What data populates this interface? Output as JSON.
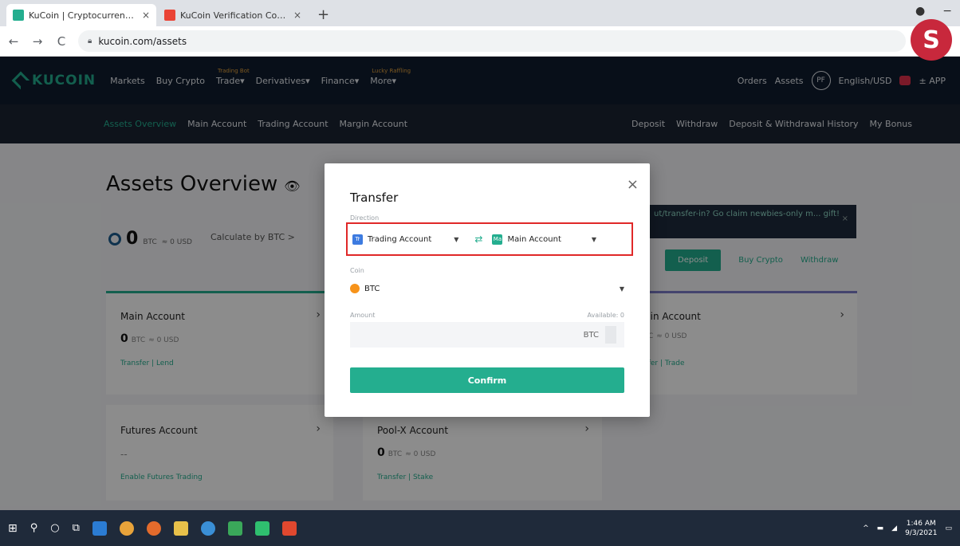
{
  "browser": {
    "tabs": [
      {
        "title": "KuCoin | Cryptocurrency Exchan...",
        "close": "×",
        "favicon_color": "#24ae8f"
      },
      {
        "title": "KuCoin Verification Code - phar...",
        "close": "×",
        "favicon_color": "#ea4335"
      }
    ],
    "new_tab": "+",
    "back": "←",
    "forward": "→",
    "reload": "C",
    "url": "kucoin.com/assets"
  },
  "header": {
    "logo": "KUCOIN",
    "nav": [
      {
        "label": "Markets",
        "tag": ""
      },
      {
        "label": "Buy Crypto",
        "tag": ""
      },
      {
        "label": "Trade",
        "tag": "Trading Bot"
      },
      {
        "label": "Derivatives",
        "tag": ""
      },
      {
        "label": "Finance",
        "tag": ""
      },
      {
        "label": "More",
        "tag": "Lucky Raffling"
      }
    ],
    "orders": "Orders",
    "assets": "Assets",
    "avatar": "PF",
    "lang": "English/USD",
    "app": "± APP"
  },
  "subnav": {
    "left": [
      "Assets Overview",
      "Main Account",
      "Trading Account",
      "Margin Account"
    ],
    "right": [
      "Deposit",
      "Withdraw",
      "Deposit & Withdrawal History",
      "My Bonus"
    ]
  },
  "overview": {
    "title": "Assets Overview",
    "balance": "0",
    "balance_unit": "BTC",
    "balance_usd": "≈ 0 USD",
    "calc": "Calculate by BTC >",
    "banner": "ut/transfer-in? Go claim newbies-only m... gift!",
    "deposit": "Deposit",
    "buy_crypto": "Buy Crypto",
    "withdraw": "Withdraw"
  },
  "cards": {
    "main": {
      "name": "Main Account",
      "value": "0",
      "unit": "BTC",
      "usd": "≈ 0 USD",
      "links": "Transfer | Lend"
    },
    "margin": {
      "name": "gin Account",
      "value": "",
      "unit": "TC",
      "usd": "≈ 0 USD",
      "links": "sfer | Trade"
    },
    "futures": {
      "name": "Futures Account",
      "dash": "--",
      "links": "Enable Futures Trading"
    },
    "poolx": {
      "name": "Pool-X Account",
      "value": "0",
      "unit": "BTC",
      "usd": "≈ 0 USD",
      "links": "Transfer | Stake"
    }
  },
  "modal": {
    "title": "Transfer",
    "close": "×",
    "direction_label": "Direction",
    "from": "Trading Account",
    "from_icon": "Tr",
    "to": "Main Account",
    "to_icon": "Ma",
    "swap": "⇄",
    "coin_label": "Coin",
    "coin": "BTC",
    "amount_label": "Amount",
    "available": "Available: 0",
    "amount_unit": "BTC",
    "confirm": "Confirm"
  },
  "taskbar": {
    "time": "1:46 AM",
    "date": "9/3/2021"
  },
  "watermark": "S"
}
